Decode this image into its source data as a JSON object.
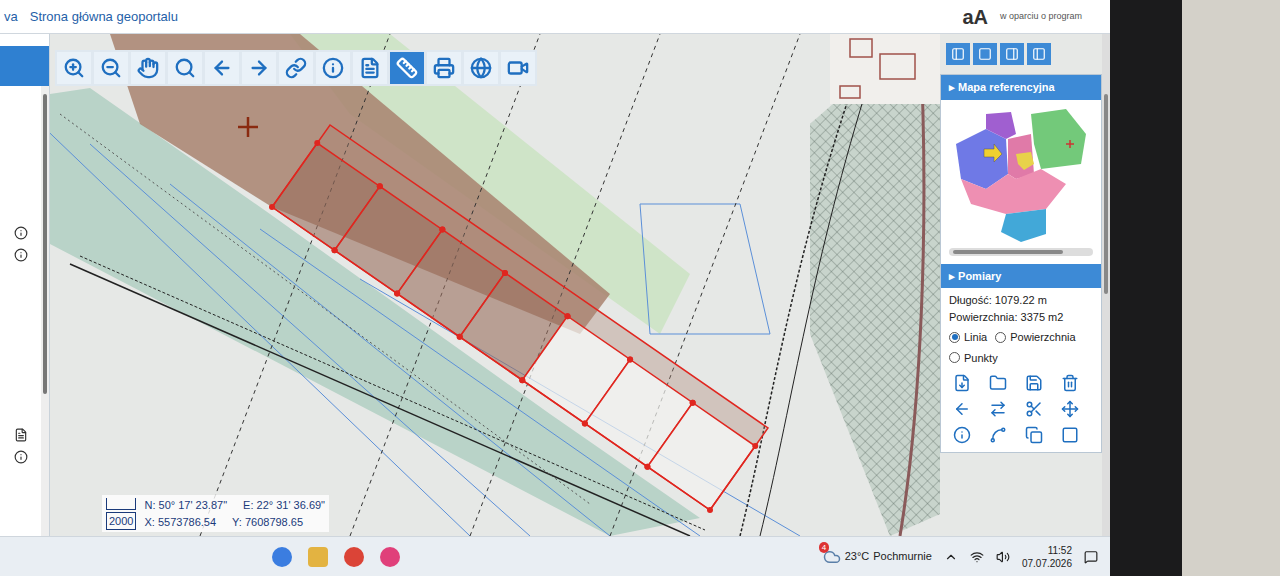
{
  "header": {
    "links": [
      "va",
      "Strona główna geoportalu"
    ],
    "font_size_button": "aA",
    "note": "w oparciu o program"
  },
  "toolbar": [
    {
      "selected": false
    },
    {
      "selected": false
    },
    {
      "selected": false
    },
    {
      "selected": false
    },
    {
      "selected": false
    },
    {
      "selected": false
    },
    {
      "selected": false
    },
    {
      "selected": false
    },
    {
      "selected": false
    },
    {
      "selected": true
    },
    {
      "selected": false
    },
    {
      "selected": false
    },
    {
      "selected": false
    }
  ],
  "reference_map": {
    "title": "Mapa referencyjna"
  },
  "measurements": {
    "title": "Pomiary",
    "length": "Długość: 1079.22 m",
    "area": "Powierzchnia: 3375 m2",
    "modes": [
      {
        "label": "Linia",
        "selected": true
      },
      {
        "label": "Powierzchnia",
        "selected": false
      },
      {
        "label": "Punkty",
        "selected": false
      }
    ]
  },
  "coordinates": {
    "n": "N: 50° 17' 23.87\"",
    "e": "E: 22° 31' 36.69\"",
    "x": "X: 5573786.54",
    "y": "Y: 7608798.65",
    "scale": "2000"
  },
  "taskbar": {
    "weather_badge": "4",
    "temperature": "23°C",
    "weather": "Pochmurnie",
    "time": "11:52",
    "date": "07.07.2026"
  }
}
